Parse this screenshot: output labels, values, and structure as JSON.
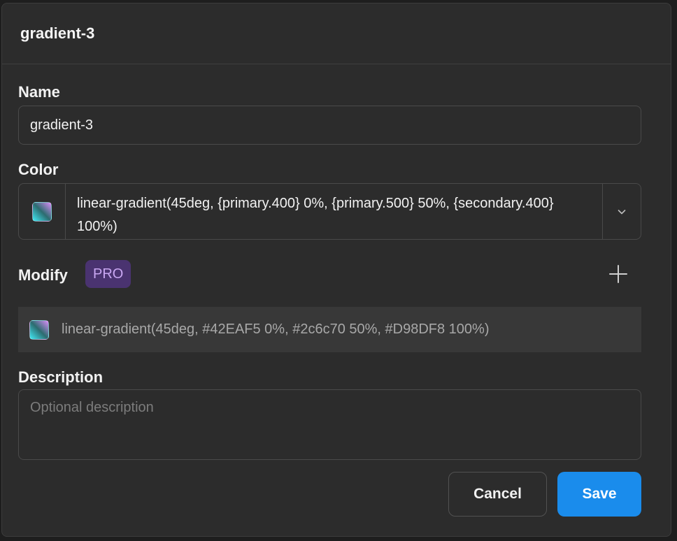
{
  "dialog": {
    "title": "gradient-3"
  },
  "name": {
    "label": "Name",
    "value": "gradient-3"
  },
  "color": {
    "label": "Color",
    "value": "linear-gradient(45deg, {primary.400} 0%, {primary.500} 50%, {secondary.400} 100%)",
    "swatch_colors": [
      "#42EAF5",
      "#2c6c70",
      "#D98DF8"
    ],
    "dropdown_icon": "chevron-down-icon"
  },
  "modify": {
    "label": "Modify",
    "badge": "PRO",
    "add_icon": "plus-icon",
    "modifier": {
      "value": "linear-gradient(45deg, #42EAF5 0%, #2c6c70 50%, #D98DF8 100%)"
    }
  },
  "description": {
    "label": "Description",
    "placeholder": "Optional description",
    "value": ""
  },
  "actions": {
    "cancel_label": "Cancel",
    "save_label": "Save"
  },
  "colors": {
    "dialog_bg": "#2c2c2c",
    "primary_button": "#1a8cec",
    "pro_badge_bg": "#4a3370",
    "pro_badge_text": "#c9a7f2"
  }
}
